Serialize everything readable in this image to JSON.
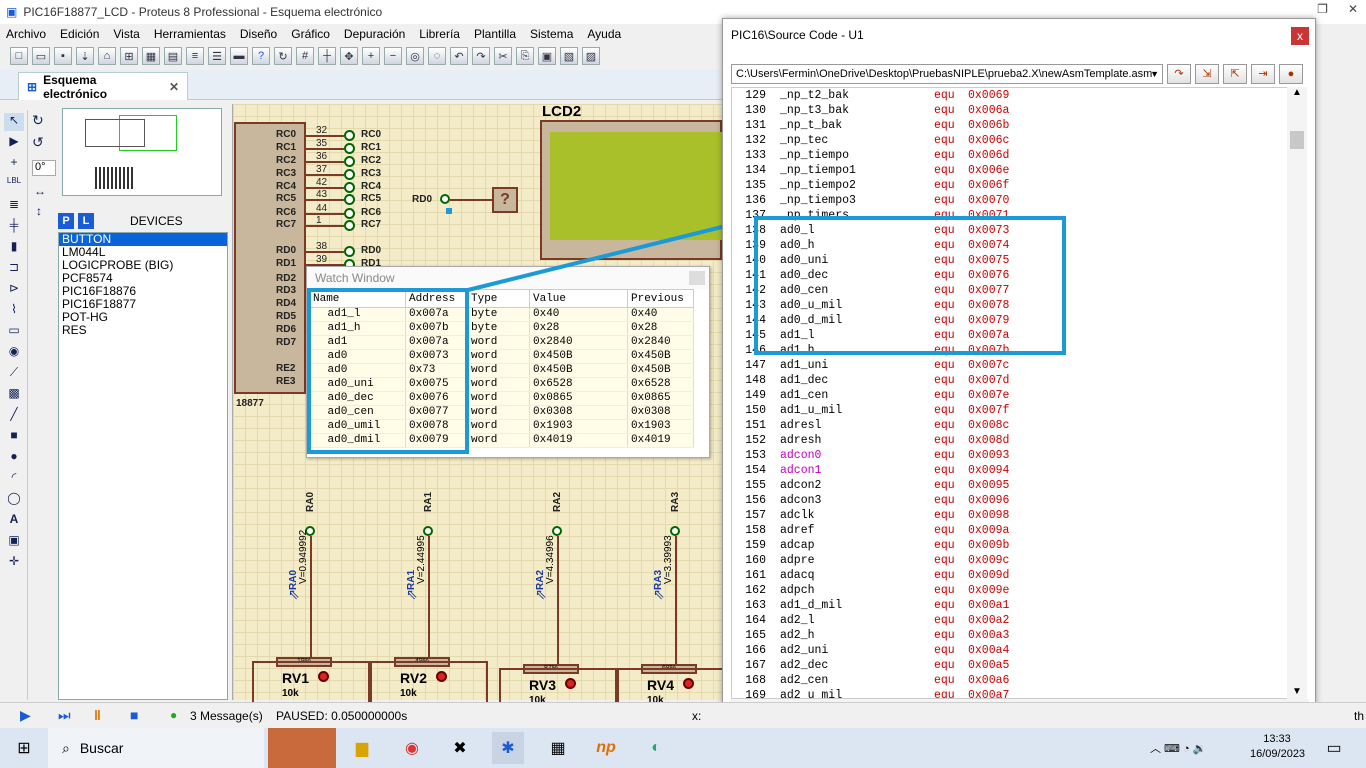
{
  "window": {
    "title": "PIC16F18877_LCD - Proteus 8 Professional - Esquema electrónico"
  },
  "menu": [
    "Archivo",
    "Edición",
    "Vista",
    "Herramientas",
    "Diseño",
    "Gráfico",
    "Depuración",
    "Librería",
    "Plantilla",
    "Sistema",
    "Ayuda"
  ],
  "tab": {
    "label": "Esquema electrónico",
    "close": "✕"
  },
  "rotation": "0°",
  "devices": {
    "header": "DEVICES",
    "p": "P",
    "l": "L",
    "items": [
      "BUTTON",
      "LM044L",
      "LOGICPROBE (BIG)",
      "PCF8574",
      "PIC16F18876",
      "PIC16F18877",
      "POT-HG",
      "RES"
    ],
    "selected": 0
  },
  "schematic": {
    "lcd_label": "LCD2",
    "chip_label": "18877",
    "probe": "?",
    "rc_pins": [
      {
        "name": "RC0",
        "num": "32"
      },
      {
        "name": "RC1",
        "num": "35"
      },
      {
        "name": "RC2",
        "num": "36"
      },
      {
        "name": "RC3",
        "num": "37"
      },
      {
        "name": "RC4",
        "num": "42"
      },
      {
        "name": "RC5",
        "num": "43"
      },
      {
        "name": "RC6",
        "num": "44"
      },
      {
        "name": "RC7",
        "num": "1"
      }
    ],
    "rd_pins": [
      {
        "name": "RD0",
        "num": "38"
      },
      {
        "name": "RD1",
        "num": "39"
      }
    ],
    "other_pins": [
      "RD2",
      "RD3",
      "RD4",
      "RD5",
      "RD6",
      "RD7",
      "RE2",
      "RE3"
    ],
    "rd0_label": "RD0",
    "pots": [
      {
        "net": "RA0",
        "probe": "RA0",
        "volt": "V=0.949992",
        "name": "RV1",
        "val": "10k",
        "pct": "19%"
      },
      {
        "net": "RA1",
        "probe": "RA1",
        "volt": "V=2.44995",
        "name": "RV2",
        "val": "10k",
        "pct": "49%"
      },
      {
        "net": "RA2",
        "probe": "RA2",
        "volt": "V=4.34996",
        "name": "RV3",
        "val": "10k",
        "pct": "87%"
      },
      {
        "net": "RA3",
        "probe": "RA3",
        "volt": "V=3.39993",
        "name": "RV4",
        "val": "10k",
        "pct": "68%"
      }
    ]
  },
  "watch": {
    "title": "Watch Window",
    "headers": [
      "Name",
      "Address",
      "Type",
      "Value",
      "Previous"
    ],
    "rows": [
      [
        "ad1_l",
        "0x007a",
        "byte",
        "0x40",
        "0x40"
      ],
      [
        "ad1_h",
        "0x007b",
        "byte",
        "0x28",
        "0x28"
      ],
      [
        "ad1",
        "0x007a",
        "word",
        "0x2840",
        "0x2840"
      ],
      [
        "ad0",
        "0x0073",
        "word",
        "0x450B",
        "0x450B"
      ],
      [
        "ad0",
        "0x73",
        "word",
        "0x450B",
        "0x450B"
      ],
      [
        "ad0_uni",
        "0x0075",
        "word",
        "0x6528",
        "0x6528"
      ],
      [
        "ad0_dec",
        "0x0076",
        "word",
        "0x0865",
        "0x0865"
      ],
      [
        "ad0_cen",
        "0x0077",
        "word",
        "0x0308",
        "0x0308"
      ],
      [
        "ad0_umil",
        "0x0078",
        "word",
        "0x1903",
        "0x1903"
      ],
      [
        "ad0_dmil",
        "0x0079",
        "word",
        "0x4019",
        "0x4019"
      ]
    ]
  },
  "source": {
    "title": "PIC16\\Source Code - U1",
    "close": "x",
    "path": "C:\\Users\\Fermin\\OneDrive\\Desktop\\PruebasNIPLE\\prueba2.X\\newAsmTemplate.asm",
    "lines": [
      [
        "129",
        "_np_t2_bak",
        "equ",
        "0x0069"
      ],
      [
        "130",
        "_np_t3_bak",
        "equ",
        "0x006a"
      ],
      [
        "131",
        "_np_t_bak",
        "equ",
        "0x006b"
      ],
      [
        "132",
        "_np_tec",
        "equ",
        "0x006c"
      ],
      [
        "133",
        "_np_tiempo",
        "equ",
        "0x006d"
      ],
      [
        "134",
        "_np_tiempo1",
        "equ",
        "0x006e"
      ],
      [
        "135",
        "_np_tiempo2",
        "equ",
        "0x006f"
      ],
      [
        "136",
        "_np_tiempo3",
        "equ",
        "0x0070"
      ],
      [
        "137",
        "_np_timers",
        "equ",
        "0x0071"
      ],
      [
        "138",
        "ad0_l",
        "equ",
        "0x0073"
      ],
      [
        "139",
        "ad0_h",
        "equ",
        "0x0074"
      ],
      [
        "140",
        "ad0_uni",
        "equ",
        "0x0075"
      ],
      [
        "141",
        "ad0_dec",
        "equ",
        "0x0076"
      ],
      [
        "142",
        "ad0_cen",
        "equ",
        "0x0077"
      ],
      [
        "143",
        "ad0_u_mil",
        "equ",
        "0x0078"
      ],
      [
        "144",
        "ad0_d_mil",
        "equ",
        "0x0079"
      ],
      [
        "145",
        "ad1_l",
        "equ",
        "0x007a"
      ],
      [
        "146",
        "ad1_h",
        "equ",
        "0x007b"
      ],
      [
        "147",
        "ad1_uni",
        "equ",
        "0x007c"
      ],
      [
        "148",
        "ad1_dec",
        "equ",
        "0x007d"
      ],
      [
        "149",
        "ad1_cen",
        "equ",
        "0x007e"
      ],
      [
        "150",
        "ad1_u_mil",
        "equ",
        "0x007f"
      ],
      [
        "151",
        "adresl",
        "equ",
        "0x008c"
      ],
      [
        "152",
        "adresh",
        "equ",
        "0x008d"
      ],
      [
        "153",
        "adcon0",
        "equ",
        "0x0093"
      ],
      [
        "154",
        "adcon1",
        "equ",
        "0x0094"
      ],
      [
        "155",
        "adcon2",
        "equ",
        "0x0095"
      ],
      [
        "156",
        "adcon3",
        "equ",
        "0x0096"
      ],
      [
        "157",
        "adclk",
        "equ",
        "0x0098"
      ],
      [
        "158",
        "adref",
        "equ",
        "0x009a"
      ],
      [
        "159",
        "adcap",
        "equ",
        "0x009b"
      ],
      [
        "160",
        "adpre",
        "equ",
        "0x009c"
      ],
      [
        "161",
        "adacq",
        "equ",
        "0x009d"
      ],
      [
        "162",
        "adpch",
        "equ",
        "0x009e"
      ],
      [
        "163",
        "ad1_d_mil",
        "equ",
        "0x00a1"
      ],
      [
        "164",
        "ad2_l",
        "equ",
        "0x00a2"
      ],
      [
        "165",
        "ad2_h",
        "equ",
        "0x00a3"
      ],
      [
        "166",
        "ad2_uni",
        "equ",
        "0x00a4"
      ],
      [
        "167",
        "ad2_dec",
        "equ",
        "0x00a5"
      ],
      [
        "168",
        "ad2_cen",
        "equ",
        "0x00a6"
      ],
      [
        "169",
        "ad2_u_mil",
        "equ",
        "0x00a7"
      ]
    ],
    "magenta_lines": [
      "153",
      "154"
    ]
  },
  "status": {
    "messages": "3 Message(s)",
    "paused": "PAUSED: 0.050000000s",
    "coord_x": "x:",
    "th": "th"
  },
  "taskbar": {
    "search": "Buscar",
    "time": "13:33",
    "date": "16/09/2023"
  },
  "colors": {
    "highlight": "#1a9ad6",
    "selection": "#0a63d8",
    "code_value": "#cc0000",
    "code_magenta": "#c000c0"
  }
}
